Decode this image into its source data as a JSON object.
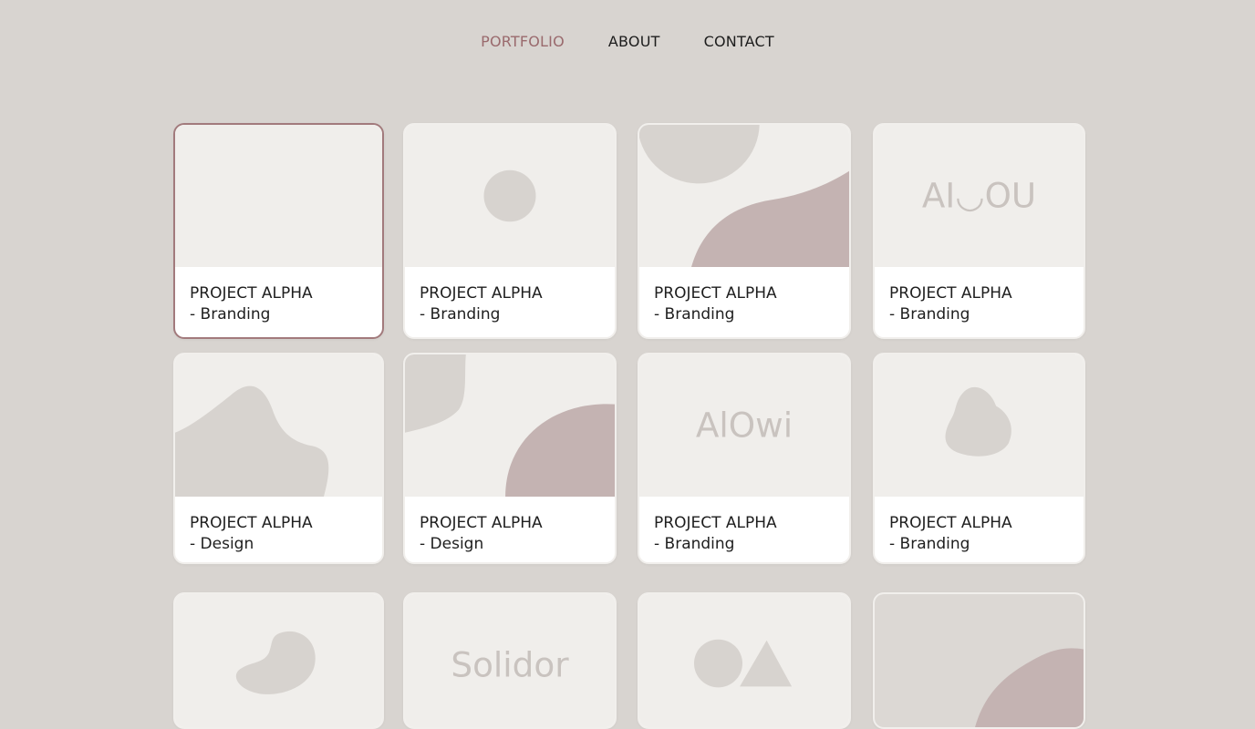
{
  "nav": {
    "items": [
      {
        "label": "PORTFOLIO",
        "active": true
      },
      {
        "label": "ABOUT",
        "active": false
      },
      {
        "label": "CONTACT",
        "active": false
      }
    ]
  },
  "colors": {
    "background": "#d8d4d0",
    "accent": "#9a6a6d",
    "thumb_bg": "#f0eeeb",
    "shape_gray": "#d7d3cf",
    "shape_rose": "#c4b3b2"
  },
  "cards": [
    {
      "title": "PROJECT ALPHA",
      "subtitle": "- Branding",
      "thumb": "blank",
      "selected": true
    },
    {
      "title": "PROJECT ALPHA",
      "subtitle": "- Branding",
      "thumb": "circle"
    },
    {
      "title": "PROJECT ALPHA",
      "subtitle": "- Branding",
      "thumb": "circle-wave"
    },
    {
      "title": "PROJECT ALPHA",
      "subtitle": "- Branding",
      "thumb": "logo-text",
      "logo_text": "AI◡OU"
    },
    {
      "title": "PROJECT ALPHA",
      "subtitle": "- Design",
      "thumb": "hill"
    },
    {
      "title": "PROJECT ALPHA",
      "subtitle": "- Design",
      "thumb": "shape-semicircle"
    },
    {
      "title": "PROJECT ALPHA",
      "subtitle": "- Branding",
      "thumb": "logo-text",
      "logo_text": "AlOwi"
    },
    {
      "title": "PROJECT ALPHA",
      "subtitle": "- Branding",
      "thumb": "blob"
    },
    {
      "title": "",
      "subtitle": "",
      "thumb": "blob2"
    },
    {
      "title": "",
      "subtitle": "",
      "thumb": "logo-text",
      "logo_text": "Solidor"
    },
    {
      "title": "",
      "subtitle": "",
      "thumb": "circle-triangle"
    },
    {
      "title": "",
      "subtitle": "",
      "thumb": "gray-wave"
    }
  ]
}
